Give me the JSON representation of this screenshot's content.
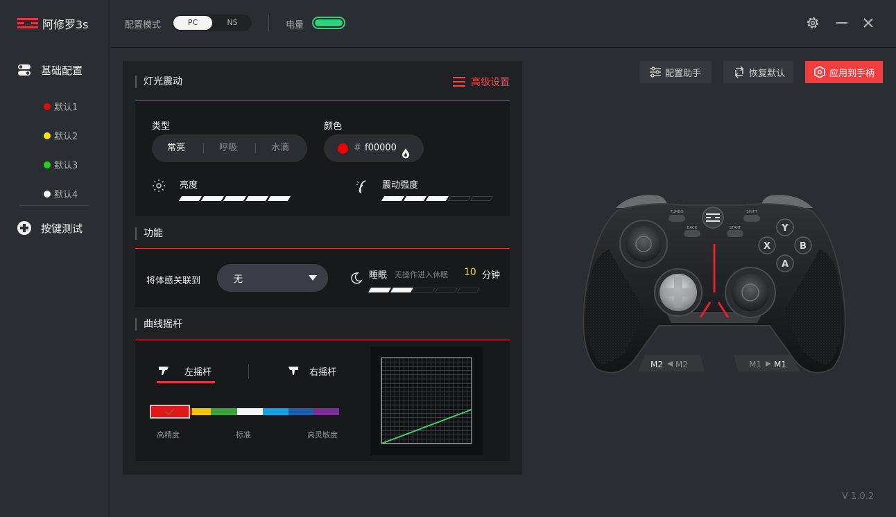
{
  "app": {
    "title": "阿修罗3s"
  },
  "sidebar": {
    "basic_config": "基础配置",
    "profiles": [
      {
        "label": "默认1",
        "color": "#e10d0d"
      },
      {
        "label": "默认2",
        "color": "#f2e21c"
      },
      {
        "label": "默认3",
        "color": "#22d31b"
      },
      {
        "label": "默认4",
        "color": "#f2f2f2"
      }
    ],
    "key_test": "按键测试"
  },
  "topbar": {
    "mode_label": "配置模式",
    "mode_pc": "PC",
    "mode_ns": "NS",
    "mode_selected": "PC",
    "battery_label": "电量",
    "battery_level": 1.0
  },
  "light": {
    "title": "灯光震动",
    "advanced": "高级设置",
    "type_label": "类型",
    "types": [
      "常亮",
      "呼吸",
      "水滴"
    ],
    "type_selected": "常亮",
    "color_label": "颜色",
    "color_hash": "#",
    "color_value": "f00000",
    "color_swatch": "#f00000",
    "brightness_label": "亮度",
    "brightness_level": 5,
    "brightness_max": 5,
    "vibration_label": "震动强度",
    "vibration_level": 3,
    "vibration_max": 5
  },
  "function": {
    "title": "功能",
    "motion_label": "将体感关联到",
    "motion_value": "无",
    "sleep_label": "睡眠",
    "sleep_hint": "无操作进入休眠",
    "sleep_minutes": "10",
    "sleep_unit": "分钟",
    "sleep_level": 2,
    "sleep_max": 5
  },
  "curve": {
    "title": "曲线摇杆",
    "left_tab": "左摇杆",
    "right_tab": "右摇杆",
    "selected_tab": "左摇杆",
    "label_precise": "高精度",
    "label_standard": "标准",
    "label_sensitive": "高灵敏度",
    "spectrum_colors": [
      "#e01818",
      "#f5c400",
      "#3aa43a",
      "#f5f5f5",
      "#18a0e6",
      "#1b5fb0",
      "#7c2c9c"
    ],
    "selected_index": 0
  },
  "actions": {
    "assistant": "配置助手",
    "restore": "恢复默认",
    "apply": "应用到手柄"
  },
  "controller": {
    "face_y": "Y",
    "face_x": "X",
    "face_b": "B",
    "face_a": "A",
    "turbo": "TURBO",
    "shift": "SHIFT",
    "back": "BACK",
    "start": "START",
    "m2_left": "M2",
    "m2_right": "M2",
    "m1_left": "M1",
    "m1_right": "M1"
  },
  "version": "V 1.0.2"
}
